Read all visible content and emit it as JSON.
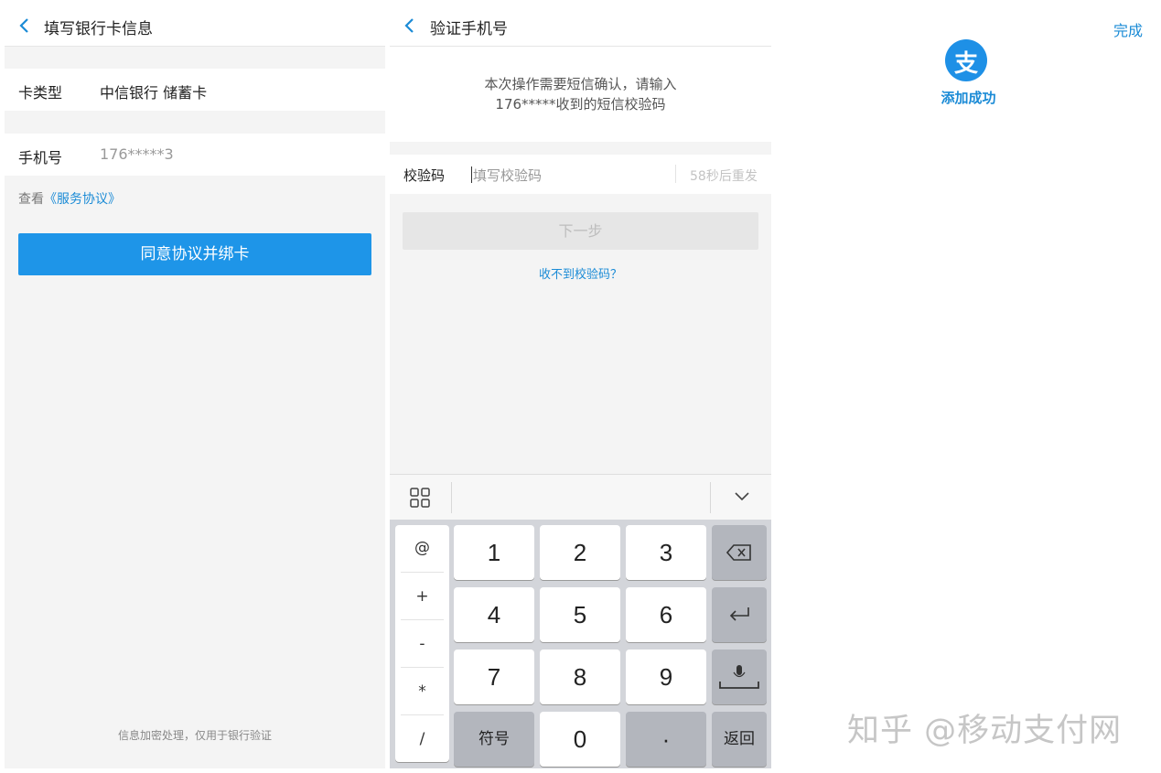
{
  "bind_card": {
    "title": "填写银行卡信息",
    "card_type_label": "卡类型",
    "card_type_value": "中信银行 储蓄卡",
    "phone_label": "手机号",
    "phone_value": "176*****3",
    "agreement_prefix": "查看",
    "agreement_link": "《服务协议》",
    "submit_label": "同意协议并绑卡",
    "footnote": "信息加密处理，仅用于银行验证"
  },
  "verify_phone": {
    "title": "验证手机号",
    "notice_line1": "本次操作需要短信确认，请输入",
    "notice_line2": "176*****收到的短信校验码",
    "code_label": "校验码",
    "code_placeholder": "填写校验码",
    "resend_text": "58秒后重发",
    "next_label": "下一步",
    "no_code_link": "收不到校验码？"
  },
  "keyboard": {
    "symbols": [
      "@",
      "+",
      "-",
      "*",
      "/"
    ],
    "keys": {
      "k1": "1",
      "k2": "2",
      "k3": "3",
      "k4": "4",
      "k5": "5",
      "k6": "6",
      "k7": "7",
      "k8": "8",
      "k9": "9",
      "k0": "0",
      "dot": "·"
    },
    "symbol_switch_label": "符号",
    "return_label": "返回",
    "icons": [
      "grid-icon",
      "chevron-down-icon",
      "backspace-icon",
      "enter-icon",
      "microphone-icon"
    ]
  },
  "success_screen": {
    "done_label": "完成",
    "logo_glyph": "支",
    "message": "添加成功",
    "watermark": "知乎 @移动支付网"
  },
  "colors": {
    "accent": "#1e95e8",
    "link": "#1b8bd6",
    "background": "#f4f4f4",
    "keyboard": "#d3d5da"
  }
}
